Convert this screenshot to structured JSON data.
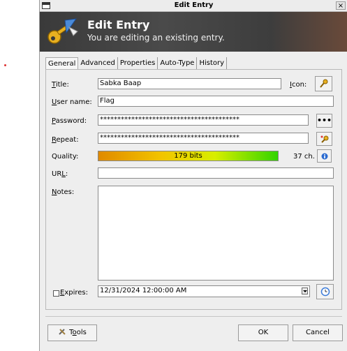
{
  "window": {
    "title": "Edit Entry",
    "close_glyph": "×"
  },
  "banner": {
    "title": "Edit Entry",
    "subtitle": "You are editing an existing entry."
  },
  "tabs": [
    {
      "label": "General",
      "active": true
    },
    {
      "label": "Advanced"
    },
    {
      "label": "Properties"
    },
    {
      "label": "Auto-Type"
    },
    {
      "label": "History"
    }
  ],
  "general": {
    "title_label_u": "T",
    "title_label_rest": "itle:",
    "title_value": "Sabka Baap",
    "icon_label_u": "I",
    "icon_label_rest": "con:",
    "username_label_u": "U",
    "username_label_rest": "ser name:",
    "username_value": "Flag",
    "password_label_u": "P",
    "password_label_rest": "assword:",
    "password_value": "****************************************",
    "repeat_label_u": "R",
    "repeat_label_rest": "epeat:",
    "repeat_value": "****************************************",
    "quality_label": "Quality:",
    "quality_text": "179 bits",
    "quality_chars": "37 ch.",
    "quality_fraction": 1.0,
    "url_label_a": "UR",
    "url_label_u": "L",
    "url_label_rest": ":",
    "url_value": "",
    "notes_label_u": "N",
    "notes_label_rest": "otes:",
    "notes_value": "",
    "expires_label_u": "E",
    "expires_label_rest": "xpires:",
    "expires_value": "12/31/2024 12:00:00 AM",
    "expires_checked": false,
    "show_password_glyph": "•••"
  },
  "footer": {
    "tools_label_a": "T",
    "tools_label_u": "o",
    "tools_label_rest": "ols",
    "ok_label": "OK",
    "cancel_label": "Cancel"
  },
  "icons": [
    "key-icon",
    "show-password-icon",
    "generate-password-icon",
    "info-icon",
    "clock-icon",
    "tools-icon",
    "window-menu-icon",
    "close-icon"
  ],
  "colors": {
    "banner_bg": "#3a3a3a",
    "quality_start": "#e08a00",
    "quality_end": "#32d400"
  }
}
